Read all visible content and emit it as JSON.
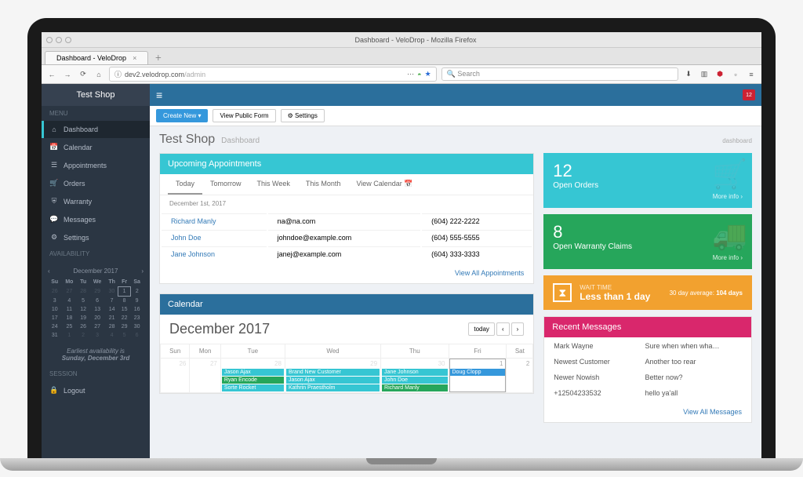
{
  "os_title": "Dashboard - VeloDrop - Mozilla Firefox",
  "browser_tab": "Dashboard - VeloDrop",
  "url_prefix": "dev2.velodrop.com",
  "url_path": "/admin",
  "search_placeholder": "Search",
  "notif_count": "12",
  "shop_name": "Test Shop",
  "sidebar": {
    "section_menu": "MENU",
    "items": [
      {
        "icon": "home-icon",
        "label": "Dashboard"
      },
      {
        "icon": "calendar-icon",
        "label": "Calendar"
      },
      {
        "icon": "list-icon",
        "label": "Appointments"
      },
      {
        "icon": "cart-icon",
        "label": "Orders"
      },
      {
        "icon": "shield-icon",
        "label": "Warranty"
      },
      {
        "icon": "chat-icon",
        "label": "Messages"
      },
      {
        "icon": "gear-icon",
        "label": "Settings"
      }
    ],
    "section_avail": "AVAILABILITY",
    "section_session": "SESSION",
    "logout": "Logout"
  },
  "minical": {
    "month": "December 2017",
    "dow": [
      "Su",
      "Mo",
      "Tu",
      "We",
      "Th",
      "Fr",
      "Sa"
    ],
    "rows": [
      [
        {
          "n": "26",
          "m": 1
        },
        {
          "n": "27",
          "m": 1
        },
        {
          "n": "28",
          "m": 1
        },
        {
          "n": "29",
          "m": 1
        },
        {
          "n": "30",
          "m": 1
        },
        {
          "n": "1",
          "c": 1
        },
        {
          "n": "2"
        }
      ],
      [
        {
          "n": "3"
        },
        {
          "n": "4"
        },
        {
          "n": "5"
        },
        {
          "n": "6"
        },
        {
          "n": "7"
        },
        {
          "n": "8"
        },
        {
          "n": "9"
        }
      ],
      [
        {
          "n": "10"
        },
        {
          "n": "11"
        },
        {
          "n": "12"
        },
        {
          "n": "13"
        },
        {
          "n": "14"
        },
        {
          "n": "15"
        },
        {
          "n": "16"
        }
      ],
      [
        {
          "n": "17"
        },
        {
          "n": "18"
        },
        {
          "n": "19"
        },
        {
          "n": "20"
        },
        {
          "n": "21"
        },
        {
          "n": "22"
        },
        {
          "n": "23"
        }
      ],
      [
        {
          "n": "24"
        },
        {
          "n": "25"
        },
        {
          "n": "26"
        },
        {
          "n": "27"
        },
        {
          "n": "28"
        },
        {
          "n": "29"
        },
        {
          "n": "30"
        }
      ],
      [
        {
          "n": "31"
        },
        {
          "n": "1",
          "m": 1
        },
        {
          "n": "2",
          "m": 1
        },
        {
          "n": "3",
          "m": 1
        },
        {
          "n": "4",
          "m": 1
        },
        {
          "n": "5",
          "m": 1
        },
        {
          "n": "6",
          "m": 1
        }
      ]
    ],
    "avail_line1": "Earliest availability is",
    "avail_line2": "Sunday, December 3rd"
  },
  "actions": {
    "create": "Create New ▾",
    "view_form": "View Public Form",
    "settings_btn": "⚙ Settings"
  },
  "page": {
    "title": "Test Shop",
    "sub": "Dashboard",
    "crumb": "dashboard"
  },
  "upcoming": {
    "title": "Upcoming Appointments",
    "tabs": [
      "Today",
      "Tomorrow",
      "This Week",
      "This Month",
      "View Calendar 📅"
    ],
    "date": "December 1st, 2017",
    "rows": [
      {
        "name": "Richard Manly",
        "email": "na@na.com",
        "phone": "(604) 222-2222"
      },
      {
        "name": "John Doe",
        "email": "johndoe@example.com",
        "phone": "(604) 555-5555"
      },
      {
        "name": "Jane Johnson",
        "email": "janej@example.com",
        "phone": "(604) 333-3333"
      }
    ],
    "view_all": "View All Appointments"
  },
  "calendar": {
    "title": "Calendar",
    "month": "December 2017",
    "today_btn": "today",
    "dow": [
      "Sun",
      "Mon",
      "Tue",
      "Wed",
      "Thu",
      "Fri",
      "Sat"
    ],
    "cells": [
      [
        {
          "n": "26",
          "m": 1
        },
        {
          "n": "27",
          "m": 1
        },
        {
          "n": "28",
          "m": 1,
          "ev": [
            {
              "t": "Jason Ajax",
              "c": "teal"
            },
            {
              "t": "Ryan Encode",
              "c": "green"
            },
            {
              "t": "Sorte Rocket",
              "c": "teal"
            }
          ]
        },
        {
          "n": "29",
          "m": 1,
          "ev": [
            {
              "t": "Brand New Customer",
              "c": "teal"
            },
            {
              "t": "Jason Ajax",
              "c": "teal"
            },
            {
              "t": "Kathrin Praestholm",
              "c": "teal"
            }
          ]
        },
        {
          "n": "30",
          "m": 1,
          "ev": [
            {
              "t": "Jane Johnson",
              "c": "teal"
            },
            {
              "t": "John Doe",
              "c": "teal"
            },
            {
              "t": "Richard Manly",
              "c": "green"
            }
          ]
        },
        {
          "n": "1",
          "td": 1,
          "ev": [
            {
              "t": "Doug Clopp",
              "c": "blue"
            }
          ]
        },
        {
          "n": "2"
        }
      ]
    ]
  },
  "stats": {
    "orders_num": "12",
    "orders_lbl": "Open Orders",
    "warranty_num": "8",
    "warranty_lbl": "Open Warranty Claims",
    "more": "More info ›",
    "wait_label": "WAIT TIME",
    "wait_val": "Less than 1 day",
    "wait_avg_pre": "30 day average:",
    "wait_avg": "104 days"
  },
  "messages": {
    "title": "Recent Messages",
    "rows": [
      {
        "from": "Mark Wayne",
        "text": "Sure when when wha…"
      },
      {
        "from": "Newest Customer",
        "text": "Another too rear"
      },
      {
        "from": "Newer Nowish",
        "text": "Better now?"
      },
      {
        "from": "+12504233532",
        "text": "hello ya'all"
      }
    ],
    "view_all": "View All Messages"
  }
}
